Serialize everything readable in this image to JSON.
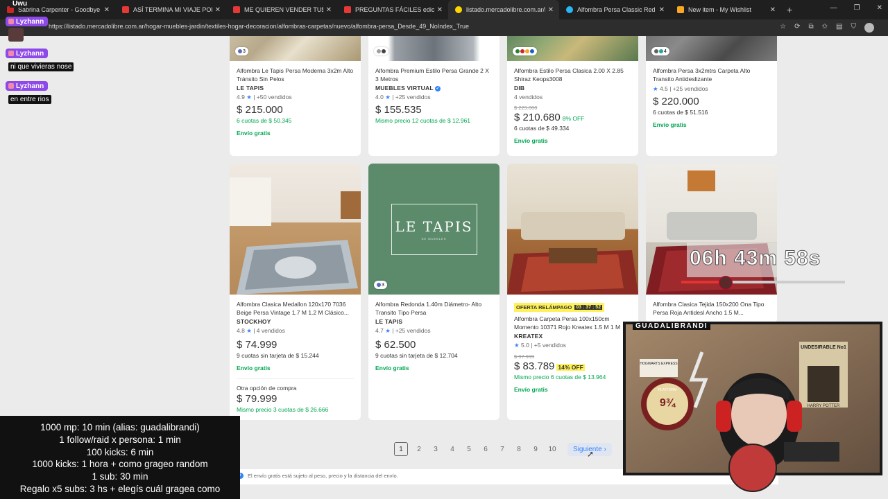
{
  "browser": {
    "tabs": [
      {
        "title": "Sabrina Carpenter - Goodbye",
        "color": "#c62828"
      },
      {
        "title": "ASÍ TERMINA MI VIAJE POR ARGE",
        "color": "#e53935"
      },
      {
        "title": "ME QUIEREN VENDER TU$$I en LA",
        "color": "#e53935"
      },
      {
        "title": "PREGUNTAS FÁCILES edicion espe",
        "color": "#e53935"
      },
      {
        "title": "listado.mercadolibre.com.ar/hogar",
        "color": "#ffd600"
      },
      {
        "title": "Alfombra Persa Classic Red Borde",
        "color": "#29b6f6"
      },
      {
        "title": "New item - My Wishlist",
        "color": "#f9a825"
      }
    ],
    "url": "https://listado.mercadolibre.com.ar/hogar-muebles-jardin/textiles-hogar-decoracion/alfombras-carpetas/nuevo/alfombra-persa_Desde_49_NoIndex_True"
  },
  "listing": {
    "row1": [
      {
        "title": "Alfombra Le Tapis Persa Moderna 3x2m Alto Tránsito Sin Pelos",
        "brand": "LE TAPIS",
        "rating": "4.9",
        "sold": "+50 vendidos",
        "price": "$ 215.000",
        "installments": "6 cuotas de $ 50.345",
        "shipping": "Envío gratis",
        "chip": "3"
      },
      {
        "title": "Alfombra Premium Estilo Persa Grande 2 X 3 Metros",
        "brand": "MUEBLES VIRTUAL",
        "rating": "4.0",
        "sold": "+25 vendidos",
        "price": "$ 155.535",
        "installments": "Mismo precio 12 cuotas de $ 12.961",
        "shipping": ""
      },
      {
        "title": "Alfombra Estilo Persa Clasica 2.00 X 2.85 Shiraz Keops3008",
        "brand": "DIB",
        "sold_only": "4 vendidos",
        "old_price": "$ 229.000",
        "price": "$ 210.680",
        "discount": "8% OFF",
        "installments": "6 cuotas de $ 49.334",
        "shipping": "Envío gratis"
      },
      {
        "title": "Alfombra Persa 3x2mtrs Carpeta Alto Transito Antideslizante",
        "rating": "4.5",
        "sold": "+25 vendidos",
        "price": "$ 220.000",
        "installments": "6 cuotas de $ 51.516",
        "shipping": "Envío gratis",
        "chip": "4"
      }
    ],
    "row2": [
      {
        "title": "Alfombra Clasica Medallon 120x170 7036 Beige Persa Vintage 1.7 M 1.2 M Clásico...",
        "brand": "STOCKHOY",
        "rating": "4.8",
        "sold": "4 vendidos",
        "price": "$ 74.999",
        "installments": "9 cuotas sin tarjeta de $ 15.244",
        "shipping": "Envío gratis",
        "alt_label": "Otra opción de compra",
        "alt_price": "$ 79.999",
        "alt_installments": "Mismo precio 3 cuotas de $ 26.666"
      },
      {
        "title": "Alfombra Redonda 1.40m Diámetro- Alto Transito Tipo Persa",
        "brand": "LE TAPIS",
        "rating": "4.7",
        "sold": "+25 vendidos",
        "price": "$ 62.500",
        "installments": "9 cuotas sin tarjeta de $ 12.704",
        "shipping": "Envío gratis",
        "image_text": "LE TAPIS",
        "image_sub": "DE MUEBLES",
        "chip": "3"
      },
      {
        "flash": "OFERTA RELÁMPAGO",
        "timer": "03 : 37 : 52",
        "title": "Alfombra Carpeta Persa 100x150cm Momento 10371 Rojo Kreatex 1.5 M 1 M",
        "brand": "KREATEX",
        "rating": "5.0",
        "sold": "+5 vendidos",
        "old_price": "$ 97.999",
        "price": "$ 83.789",
        "discount": "14% OFF",
        "installments": "Mismo precio 6 cuotas de $ 13.964",
        "shipping": "Envío gratis"
      },
      {
        "title": "Alfombra Clasica Tejida 150x200 Ona Tipo Persa Roja Antidesl Ancho 1.5 M..."
      }
    ]
  },
  "pagination": {
    "pages": [
      "1",
      "2",
      "3",
      "4",
      "5",
      "6",
      "7",
      "8",
      "9",
      "10"
    ],
    "current": "1",
    "next": "Siguiente"
  },
  "footnote": "El envío gratis está sujeto al peso, precio y la distancia del envío.",
  "stream": {
    "top_label": "Uwu",
    "chat": [
      {
        "user": "Lyzhann",
        "msg": ""
      },
      {
        "user": "Lyzhann",
        "msg": "ni que vivieras nose"
      },
      {
        "user": "Lyzhann",
        "msg": "en entre rios"
      }
    ],
    "rules": [
      "1000 mp: 10 min (alias: guadalibrandi)",
      "1 follow/raid x persona: 1 min",
      "100 kicks: 6 min",
      "1000 kicks: 1 hora + como grageo random",
      "1 sub: 30 min",
      "Regalo x5 subs: 3 hs + elegís cuál gragea como"
    ],
    "timer": "06h 43m 58s",
    "cam_label": "GUADALIBRANDI",
    "poster_title": "UNDESIRABLE No1",
    "poster_name": "HARRY POTTER",
    "platform": "9¾",
    "platform_word": "PLATFORM",
    "hogwarts": "HOGWARTS EXPRESS"
  }
}
